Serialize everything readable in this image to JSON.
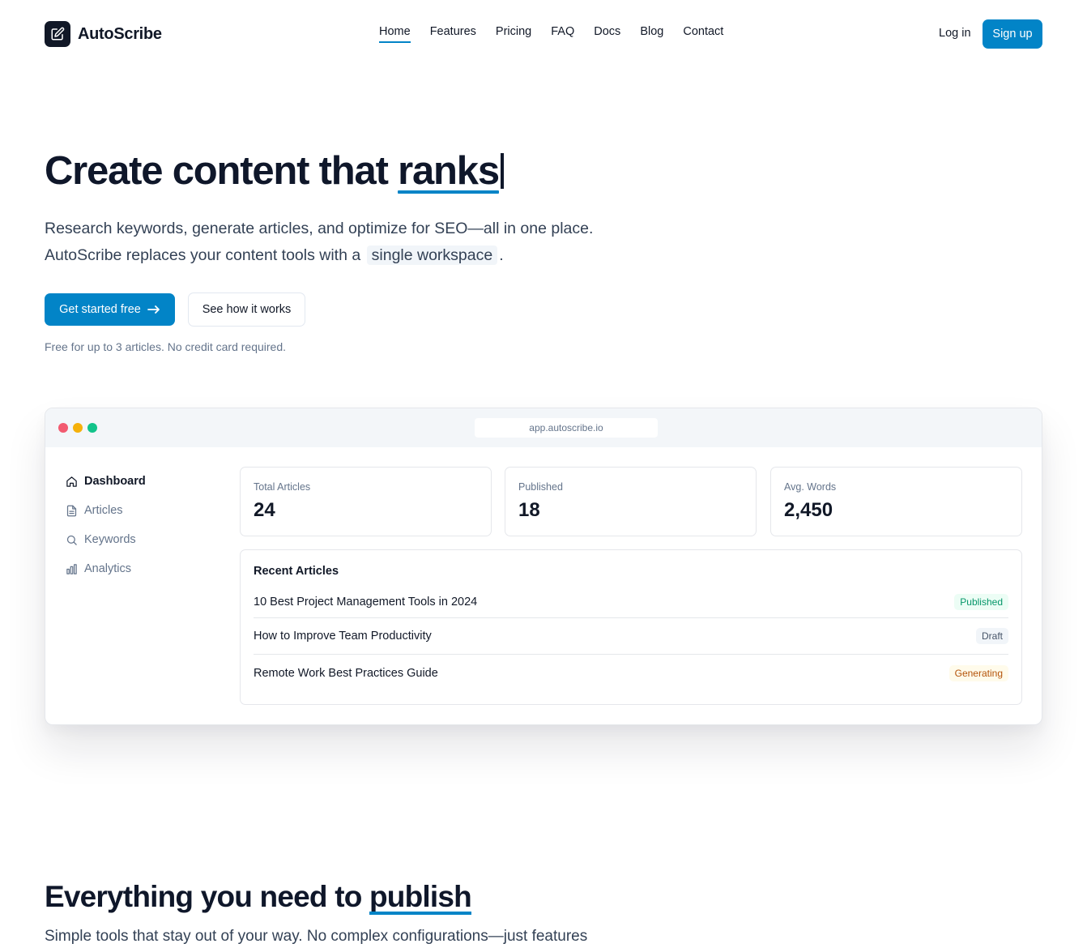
{
  "brand": {
    "name": "AutoScribe",
    "icon": "pencil-square-icon"
  },
  "nav": {
    "items": [
      {
        "label": "Home",
        "active": true
      },
      {
        "label": "Features",
        "active": false
      },
      {
        "label": "Pricing",
        "active": false
      },
      {
        "label": "FAQ",
        "active": false
      },
      {
        "label": "Docs",
        "active": false
      },
      {
        "label": "Blog",
        "active": false
      },
      {
        "label": "Contact",
        "active": false
      }
    ],
    "login": "Log in",
    "signup": "Sign up"
  },
  "hero": {
    "title_prefix": "Create content that ",
    "title_accent": "ranks",
    "subtitle_line1": "Research keywords, generate articles, and optimize for SEO—all in one place.",
    "subtitle_line2_prefix": "AutoScribe replaces your content tools with a",
    "subtitle_highlight": "single workspace",
    "subtitle_line2_suffix": ".",
    "cta_primary": "Get started free",
    "cta_secondary": "See how it works",
    "fine_print": "Free for up to 3 articles. No credit card required."
  },
  "preview": {
    "url": "app.autoscribe.io",
    "sidebar": [
      {
        "label": "Dashboard",
        "icon": "home-icon",
        "active": true
      },
      {
        "label": "Articles",
        "icon": "document-icon",
        "active": false
      },
      {
        "label": "Keywords",
        "icon": "search-icon",
        "active": false
      },
      {
        "label": "Analytics",
        "icon": "bar-chart-icon",
        "active": false
      }
    ],
    "stats": [
      {
        "label": "Total Articles",
        "value": "24"
      },
      {
        "label": "Published",
        "value": "18"
      },
      {
        "label": "Avg. Words",
        "value": "2,450"
      }
    ],
    "recent_title": "Recent Articles",
    "articles": [
      {
        "title": "10 Best Project Management Tools in 2024",
        "status": "Published"
      },
      {
        "title": "How to Improve Team Productivity",
        "status": "Draft"
      },
      {
        "title": "Remote Work Best Practices Guide",
        "status": "Generating"
      }
    ]
  },
  "features": {
    "title_prefix": "Everything you need to ",
    "title_accent": "publish",
    "subtitle": "Simple tools that stay out of your way. No complex configurations—just features"
  },
  "colors": {
    "accent": "#0284c7",
    "text": "#0f172a",
    "muted": "#64748b",
    "published": "#059669",
    "generating": "#b45309"
  }
}
